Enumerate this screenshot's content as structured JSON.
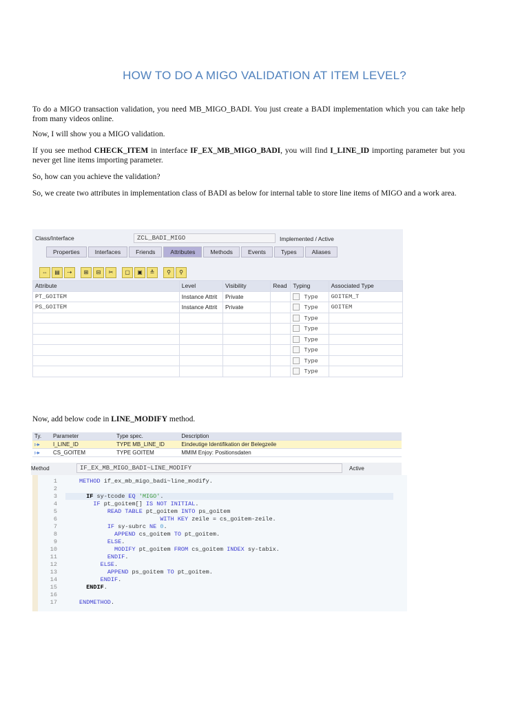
{
  "title": "HOW TO DO A MIGO VALIDATION AT ITEM LEVEL?",
  "paragraphs": [
    [
      {
        "t": "To do a MIGO transaction validation, you need MB_MIGO_BADI. You just create a BADI implementation which you can take help from many videos online."
      }
    ],
    [
      {
        "t": "Now, I will show you a MIGO validation."
      }
    ],
    [
      {
        "t": "If you see method "
      },
      {
        "t": "CHECK_ITEM",
        "b": true
      },
      {
        "t": " in interface "
      },
      {
        "t": "IF_EX_MB_MIGO_BADI",
        "b": true
      },
      {
        "t": ", you will find "
      },
      {
        "t": "I_LINE_ID",
        "b": true
      },
      {
        "t": " importing parameter but you never get line items importing parameter."
      }
    ],
    [
      {
        "t": "So, how can you achieve the validation?"
      }
    ],
    [
      {
        "t": "So, we create two attributes in implementation class of BADI as below for internal table to store line items of MIGO and a work area."
      }
    ],
    [
      {
        "t": "Now, add below code in "
      },
      {
        "t": "LINE_MODIFY",
        "b": true
      },
      {
        "t": " method."
      }
    ]
  ],
  "class_screen": {
    "label": "Class/Interface",
    "class_name": "ZCL_BADI_MIGO",
    "status": "Implemented / Active",
    "tabs": [
      "Properties",
      "Interfaces",
      "Friends",
      "Attributes",
      "Methods",
      "Events",
      "Types",
      "Aliases"
    ],
    "active_tab": "Attributes",
    "toolbar_icons": [
      "insert-row-icon",
      "copy-icon",
      "move-icon",
      "add-icon",
      "remove-icon",
      "cut-icon",
      "copy2-icon",
      "paste-icon",
      "details-icon",
      "find-icon",
      "find-next-icon"
    ],
    "columns": [
      "Attribute",
      "Level",
      "Visibility",
      "Read",
      "Typing",
      "Associated Type"
    ],
    "rows": [
      [
        "PT_GOITEM",
        "Instance Attrit",
        "Private",
        "",
        "Type",
        "GOITEM_T"
      ],
      [
        "PS_GOITEM",
        "Instance Attrit",
        "Private",
        "",
        "Type",
        "GOITEM"
      ],
      [
        "",
        "",
        "",
        "",
        "Type",
        ""
      ],
      [
        "",
        "",
        "",
        "",
        "Type",
        ""
      ],
      [
        "",
        "",
        "",
        "",
        "Type",
        ""
      ],
      [
        "",
        "",
        "",
        "",
        "Type",
        ""
      ],
      [
        "",
        "",
        "",
        "",
        "Type",
        ""
      ],
      [
        "",
        "",
        "",
        "",
        "Type",
        ""
      ]
    ]
  },
  "method_screen": {
    "columns": [
      "Ty.",
      "Parameter",
      "Type spec.",
      "Description"
    ],
    "params": [
      [
        "I_LINE_ID",
        "TYPE MB_LINE_ID",
        "Eindeutige Identifikation der Belegzeile"
      ],
      [
        "CS_GOITEM",
        "TYPE GOITEM",
        "MMIM Enjoy: Positionsdaten"
      ]
    ],
    "method_label": "Method",
    "method_name": "IF_EX_MB_MIGO_BADI~LINE_MODIFY",
    "status": "Active",
    "code": [
      [
        [
          "k",
          "METHOD "
        ],
        [
          "p",
          "if_ex_mb_migo_badi~line_modify."
        ]
      ],
      [],
      [
        [
          "p",
          "  "
        ],
        [
          "b",
          "IF"
        ],
        [
          "p",
          " sy-tcode "
        ],
        [
          "k",
          "EQ "
        ],
        [
          "s",
          "'MIGO'"
        ],
        [
          "p",
          "."
        ]
      ],
      [
        [
          "p",
          "    "
        ],
        [
          "k",
          "IF"
        ],
        [
          "p",
          " pt_goitem[] "
        ],
        [
          "k",
          "IS NOT INITIAL"
        ],
        [
          "p",
          "."
        ]
      ],
      [
        [
          "p",
          "        "
        ],
        [
          "k",
          "READ TABLE"
        ],
        [
          "p",
          " pt_goitem "
        ],
        [
          "k",
          "INTO"
        ],
        [
          "p",
          " ps_goitem"
        ]
      ],
      [
        [
          "p",
          "                       "
        ],
        [
          "k",
          "WITH KEY"
        ],
        [
          "p",
          " zeile = cs_goitem-zeile."
        ]
      ],
      [
        [
          "p",
          "        "
        ],
        [
          "k",
          "IF"
        ],
        [
          "p",
          " sy-subrc "
        ],
        [
          "k",
          "NE "
        ],
        [
          "n",
          "0"
        ],
        [
          "p",
          "."
        ]
      ],
      [
        [
          "p",
          "          "
        ],
        [
          "k",
          "APPEND"
        ],
        [
          "p",
          " cs_goitem "
        ],
        [
          "k",
          "TO"
        ],
        [
          "p",
          " pt_goitem."
        ]
      ],
      [
        [
          "p",
          "        "
        ],
        [
          "k",
          "ELSE"
        ],
        [
          "p",
          "."
        ]
      ],
      [
        [
          "p",
          "          "
        ],
        [
          "k",
          "MODIFY"
        ],
        [
          "p",
          " pt_goitem "
        ],
        [
          "k",
          "FROM"
        ],
        [
          "p",
          " cs_goitem "
        ],
        [
          "k",
          "INDEX"
        ],
        [
          "p",
          " sy-tabix."
        ]
      ],
      [
        [
          "p",
          "        "
        ],
        [
          "k",
          "ENDIF"
        ],
        [
          "p",
          "."
        ]
      ],
      [
        [
          "p",
          "      "
        ],
        [
          "k",
          "ELSE"
        ],
        [
          "p",
          "."
        ]
      ],
      [
        [
          "p",
          "        "
        ],
        [
          "k",
          "APPEND"
        ],
        [
          "p",
          " ps_goitem "
        ],
        [
          "k",
          "TO"
        ],
        [
          "p",
          " pt_goitem."
        ]
      ],
      [
        [
          "p",
          "      "
        ],
        [
          "k",
          "ENDIF"
        ],
        [
          "p",
          "."
        ]
      ],
      [
        [
          "p",
          "  "
        ],
        [
          "b",
          "ENDIF"
        ],
        [
          "p",
          "."
        ]
      ],
      [],
      [
        [
          "k",
          "ENDMETHOD"
        ],
        [
          "p",
          "."
        ]
      ]
    ]
  }
}
